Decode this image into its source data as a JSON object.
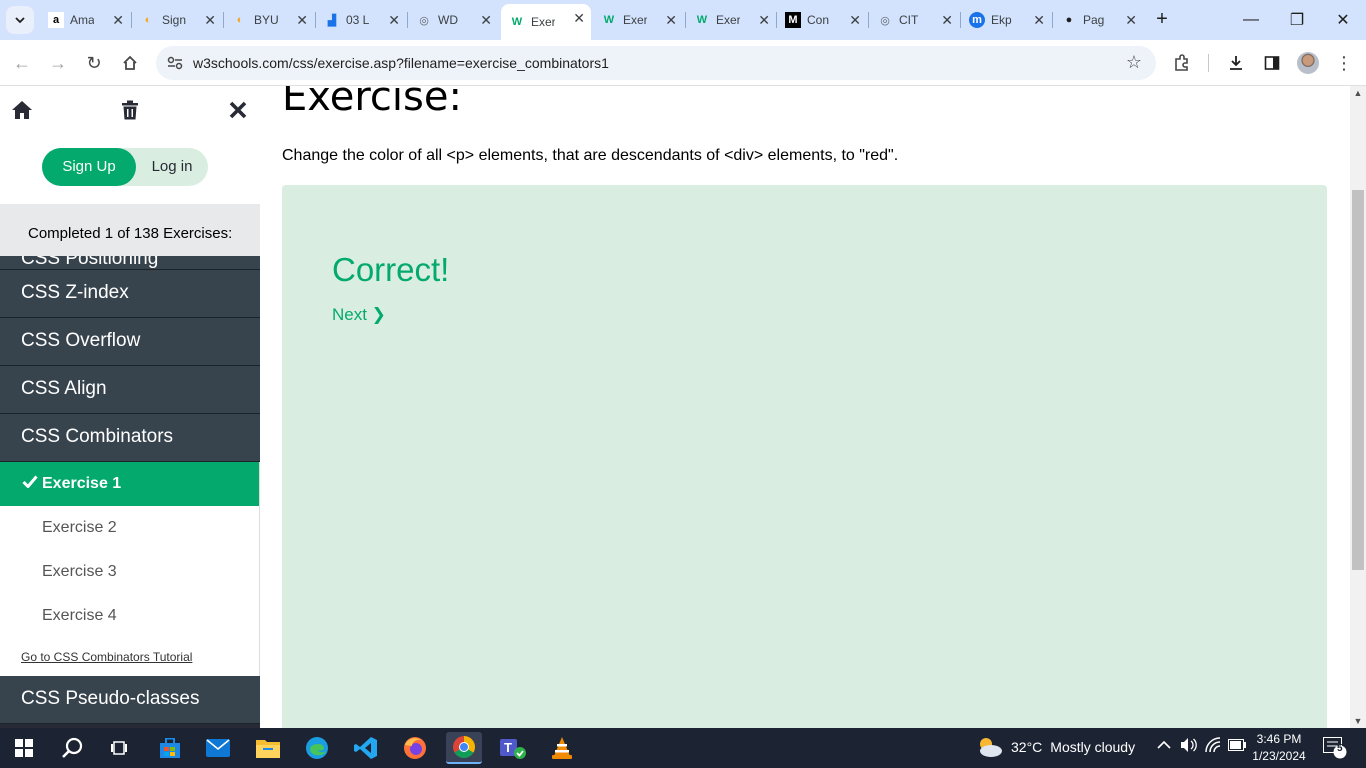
{
  "browser": {
    "tabs": [
      {
        "title": "Ama",
        "icon": "amazon-icon"
      },
      {
        "title": "Sign",
        "icon": "byu-icon"
      },
      {
        "title": "BYU",
        "icon": "byu-icon"
      },
      {
        "title": "03 L",
        "icon": "chart-icon"
      },
      {
        "title": "WD",
        "icon": "globe-icon"
      },
      {
        "title": "Exer",
        "icon": "w3schools-icon",
        "active": true
      },
      {
        "title": "Exer",
        "icon": "w3schools-icon"
      },
      {
        "title": "Exer",
        "icon": "w3schools-icon"
      },
      {
        "title": "Con",
        "icon": "m-icon"
      },
      {
        "title": "CIT",
        "icon": "globe-icon"
      },
      {
        "title": "Ekp",
        "icon": "messenger-icon"
      },
      {
        "title": "Pag",
        "icon": "github-icon"
      }
    ],
    "url": "w3schools.com/css/exercise.asp?filename=exercise_combinators1"
  },
  "sidebar": {
    "signup_label": "Sign Up",
    "login_label": "Log in",
    "progress_text": "Completed 1 of 138 Exercises:",
    "sections": [
      {
        "label": "CSS Positioning",
        "partial": true
      },
      {
        "label": "CSS Z-index"
      },
      {
        "label": "CSS Overflow"
      },
      {
        "label": "CSS Align"
      },
      {
        "label": "CSS Combinators"
      }
    ],
    "exercises": [
      {
        "label": "Exercise 1",
        "active": true,
        "completed": true
      },
      {
        "label": "Exercise 2"
      },
      {
        "label": "Exercise 3"
      },
      {
        "label": "Exercise 4"
      }
    ],
    "tutorial_link": "Go to CSS Combinators Tutorial",
    "after_section": "CSS Pseudo-classes"
  },
  "main": {
    "title": "Exercise:",
    "instruction": "Change the color of all <p> elements, that are descendants of <div> elements, to \"red\".",
    "result_text": "Correct!",
    "next_label": "Next ❯"
  },
  "taskbar": {
    "weather_temp": "32°C",
    "weather_desc": "Mostly cloudy",
    "time": "3:46 PM",
    "date": "1/23/2024",
    "notification_count": "5"
  },
  "colors": {
    "accent": "#04aa6d",
    "panel": "#d9eee1",
    "sidebar_dark": "#38444d"
  }
}
